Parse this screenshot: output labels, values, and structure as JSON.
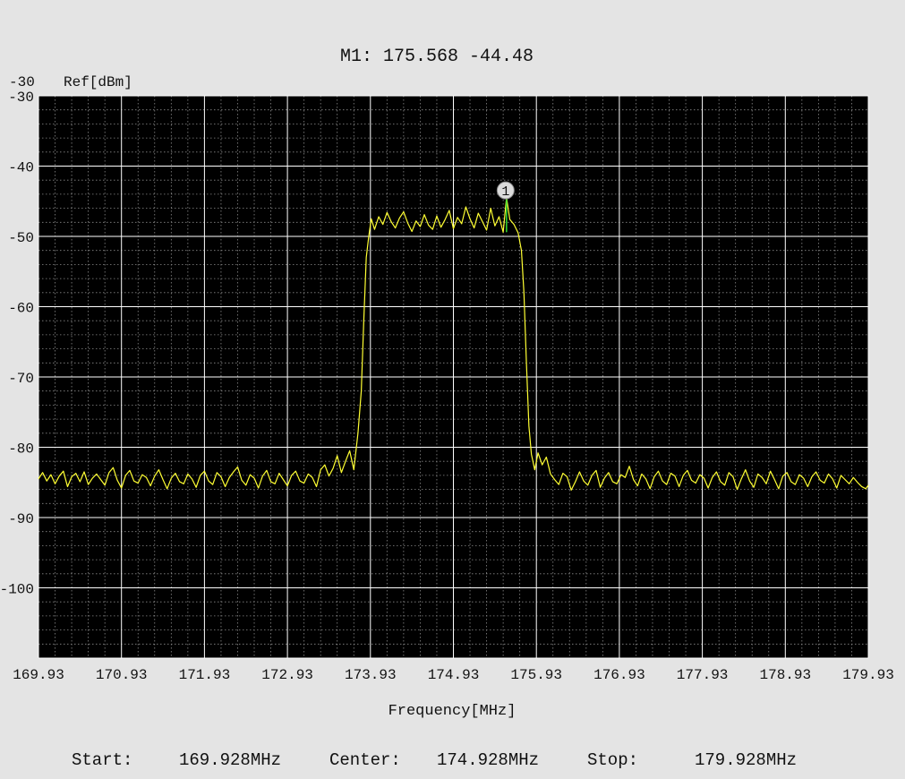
{
  "chart_data": {
    "type": "line",
    "marker_readout": "M1: 175.568 -44.48",
    "ref_value": "-30",
    "ref_label": "Ref[dBm]",
    "xlabel": "Frequency[MHz]",
    "ylabel": "",
    "xlim": [
      169.928,
      179.928
    ],
    "ylim": [
      -110,
      -30
    ],
    "x_ticks": [
      "169.93",
      "170.93",
      "171.93",
      "172.93",
      "173.93",
      "174.93",
      "175.93",
      "176.93",
      "177.93",
      "178.93",
      "179.93"
    ],
    "y_ticks": [
      "-30",
      "-40",
      "-50",
      "-60",
      "-70",
      "-80",
      "-90",
      "-100"
    ],
    "grid": true,
    "trace_color": "#ffff33",
    "plot_background": "#000000",
    "grid_color": "#ffffff",
    "marker_color": "#33dd33",
    "marker": {
      "label": "1",
      "x": 175.568,
      "y": -44.48
    },
    "series": [
      {
        "values": [
          [
            169.928,
            -84.5
          ],
          [
            169.978,
            -83.6
          ],
          [
            170.028,
            -84.8
          ],
          [
            170.078,
            -83.9
          ],
          [
            170.128,
            -85.2
          ],
          [
            170.178,
            -84.1
          ],
          [
            170.228,
            -83.4
          ],
          [
            170.278,
            -85.6
          ],
          [
            170.328,
            -84.2
          ],
          [
            170.378,
            -83.7
          ],
          [
            170.428,
            -84.9
          ],
          [
            170.478,
            -83.5
          ],
          [
            170.528,
            -85.3
          ],
          [
            170.578,
            -84.4
          ],
          [
            170.628,
            -83.8
          ],
          [
            170.678,
            -84.6
          ],
          [
            170.728,
            -85.4
          ],
          [
            170.778,
            -83.6
          ],
          [
            170.828,
            -82.9
          ],
          [
            170.878,
            -84.7
          ],
          [
            170.928,
            -85.8
          ],
          [
            170.978,
            -84.0
          ],
          [
            171.028,
            -83.3
          ],
          [
            171.078,
            -84.8
          ],
          [
            171.128,
            -85.1
          ],
          [
            171.178,
            -83.9
          ],
          [
            171.228,
            -84.3
          ],
          [
            171.278,
            -85.5
          ],
          [
            171.328,
            -84.1
          ],
          [
            171.378,
            -83.2
          ],
          [
            171.428,
            -84.6
          ],
          [
            171.478,
            -85.9
          ],
          [
            171.528,
            -84.4
          ],
          [
            171.578,
            -83.7
          ],
          [
            171.628,
            -84.9
          ],
          [
            171.678,
            -85.2
          ],
          [
            171.728,
            -83.8
          ],
          [
            171.778,
            -84.5
          ],
          [
            171.828,
            -85.7
          ],
          [
            171.878,
            -84.0
          ],
          [
            171.928,
            -83.4
          ],
          [
            171.978,
            -84.8
          ],
          [
            172.028,
            -85.3
          ],
          [
            172.078,
            -83.6
          ],
          [
            172.128,
            -84.2
          ],
          [
            172.178,
            -85.6
          ],
          [
            172.228,
            -84.3
          ],
          [
            172.278,
            -83.5
          ],
          [
            172.328,
            -82.8
          ],
          [
            172.378,
            -84.7
          ],
          [
            172.428,
            -85.4
          ],
          [
            172.478,
            -83.9
          ],
          [
            172.528,
            -84.4
          ],
          [
            172.578,
            -85.8
          ],
          [
            172.628,
            -84.1
          ],
          [
            172.678,
            -83.3
          ],
          [
            172.728,
            -84.9
          ],
          [
            172.778,
            -85.2
          ],
          [
            172.828,
            -83.7
          ],
          [
            172.878,
            -84.6
          ],
          [
            172.928,
            -85.5
          ],
          [
            172.978,
            -84.0
          ],
          [
            173.028,
            -83.4
          ],
          [
            173.078,
            -84.8
          ],
          [
            173.128,
            -85.1
          ],
          [
            173.178,
            -83.8
          ],
          [
            173.228,
            -84.3
          ],
          [
            173.278,
            -85.6
          ],
          [
            173.328,
            -83.2
          ],
          [
            173.378,
            -82.5
          ],
          [
            173.428,
            -84.1
          ],
          [
            173.478,
            -83.0
          ],
          [
            173.528,
            -81.2
          ],
          [
            173.578,
            -83.6
          ],
          [
            173.628,
            -82.0
          ],
          [
            173.678,
            -80.5
          ],
          [
            173.728,
            -83.2
          ],
          [
            173.778,
            -78.0
          ],
          [
            173.818,
            -72.0
          ],
          [
            173.848,
            -62.0
          ],
          [
            173.878,
            -53.0
          ],
          [
            173.908,
            -50.0
          ],
          [
            173.938,
            -47.5
          ],
          [
            173.978,
            -49.0
          ],
          [
            174.028,
            -47.2
          ],
          [
            174.078,
            -48.3
          ],
          [
            174.128,
            -46.6
          ],
          [
            174.178,
            -47.9
          ],
          [
            174.228,
            -48.8
          ],
          [
            174.278,
            -47.4
          ],
          [
            174.328,
            -46.5
          ],
          [
            174.378,
            -48.1
          ],
          [
            174.428,
            -49.3
          ],
          [
            174.478,
            -47.8
          ],
          [
            174.528,
            -48.6
          ],
          [
            174.578,
            -46.9
          ],
          [
            174.628,
            -48.4
          ],
          [
            174.678,
            -49.0
          ],
          [
            174.728,
            -47.1
          ],
          [
            174.778,
            -48.7
          ],
          [
            174.828,
            -47.6
          ],
          [
            174.878,
            -46.3
          ],
          [
            174.928,
            -48.9
          ],
          [
            174.978,
            -47.3
          ],
          [
            175.028,
            -48.2
          ],
          [
            175.078,
            -45.8
          ],
          [
            175.128,
            -47.5
          ],
          [
            175.178,
            -48.8
          ],
          [
            175.228,
            -46.7
          ],
          [
            175.278,
            -47.9
          ],
          [
            175.328,
            -49.1
          ],
          [
            175.378,
            -46.0
          ],
          [
            175.428,
            -48.5
          ],
          [
            175.478,
            -47.2
          ],
          [
            175.528,
            -49.4
          ],
          [
            175.568,
            -44.48
          ],
          [
            175.608,
            -47.6
          ],
          [
            175.658,
            -48.3
          ],
          [
            175.708,
            -49.5
          ],
          [
            175.748,
            -52.0
          ],
          [
            175.778,
            -58.0
          ],
          [
            175.808,
            -68.0
          ],
          [
            175.838,
            -77.0
          ],
          [
            175.868,
            -81.0
          ],
          [
            175.908,
            -83.2
          ],
          [
            175.948,
            -80.8
          ],
          [
            175.998,
            -82.5
          ],
          [
            176.048,
            -81.4
          ],
          [
            176.098,
            -83.8
          ],
          [
            176.148,
            -84.6
          ],
          [
            176.198,
            -85.3
          ],
          [
            176.248,
            -83.7
          ],
          [
            176.298,
            -84.2
          ],
          [
            176.348,
            -86.1
          ],
          [
            176.398,
            -84.9
          ],
          [
            176.448,
            -83.5
          ],
          [
            176.498,
            -84.8
          ],
          [
            176.548,
            -85.4
          ],
          [
            176.598,
            -84.0
          ],
          [
            176.648,
            -83.3
          ],
          [
            176.698,
            -85.7
          ],
          [
            176.748,
            -84.4
          ],
          [
            176.798,
            -83.6
          ],
          [
            176.848,
            -84.9
          ],
          [
            176.898,
            -85.2
          ],
          [
            176.948,
            -83.9
          ],
          [
            176.998,
            -84.3
          ],
          [
            177.048,
            -82.7
          ],
          [
            177.098,
            -84.6
          ],
          [
            177.148,
            -85.5
          ],
          [
            177.198,
            -83.8
          ],
          [
            177.248,
            -84.5
          ],
          [
            177.298,
            -85.9
          ],
          [
            177.348,
            -84.2
          ],
          [
            177.398,
            -83.4
          ],
          [
            177.448,
            -84.8
          ],
          [
            177.498,
            -85.3
          ],
          [
            177.548,
            -83.7
          ],
          [
            177.598,
            -84.1
          ],
          [
            177.648,
            -85.6
          ],
          [
            177.698,
            -84.0
          ],
          [
            177.748,
            -83.3
          ],
          [
            177.798,
            -84.7
          ],
          [
            177.848,
            -85.1
          ],
          [
            177.898,
            -83.9
          ],
          [
            177.948,
            -84.4
          ],
          [
            177.998,
            -85.8
          ],
          [
            178.048,
            -84.3
          ],
          [
            178.098,
            -83.5
          ],
          [
            178.148,
            -84.9
          ],
          [
            178.198,
            -85.4
          ],
          [
            178.248,
            -83.6
          ],
          [
            178.298,
            -84.2
          ],
          [
            178.348,
            -86.0
          ],
          [
            178.398,
            -84.5
          ],
          [
            178.448,
            -83.2
          ],
          [
            178.498,
            -84.8
          ],
          [
            178.548,
            -85.7
          ],
          [
            178.598,
            -83.8
          ],
          [
            178.648,
            -84.3
          ],
          [
            178.698,
            -85.2
          ],
          [
            178.748,
            -83.4
          ],
          [
            178.798,
            -84.6
          ],
          [
            178.848,
            -85.9
          ],
          [
            178.898,
            -84.1
          ],
          [
            178.948,
            -83.6
          ],
          [
            178.998,
            -84.9
          ],
          [
            179.048,
            -85.3
          ],
          [
            179.098,
            -83.9
          ],
          [
            179.148,
            -84.4
          ],
          [
            179.198,
            -85.6
          ],
          [
            179.248,
            -84.2
          ],
          [
            179.298,
            -83.5
          ],
          [
            179.348,
            -84.7
          ],
          [
            179.398,
            -85.1
          ],
          [
            179.448,
            -83.8
          ],
          [
            179.498,
            -84.5
          ],
          [
            179.548,
            -85.8
          ],
          [
            179.598,
            -84.0
          ],
          [
            179.648,
            -84.6
          ],
          [
            179.698,
            -85.2
          ],
          [
            179.748,
            -84.3
          ],
          [
            179.798,
            -85.0
          ],
          [
            179.848,
            -85.6
          ],
          [
            179.898,
            -85.9
          ],
          [
            179.928,
            -85.4
          ]
        ]
      }
    ]
  },
  "footer": {
    "start_label": "Start:",
    "start_value": "169.928MHz",
    "center_label": "Center:",
    "center_value": "174.928MHz",
    "stop_label": "Stop:",
    "stop_value": "179.928MHz"
  }
}
